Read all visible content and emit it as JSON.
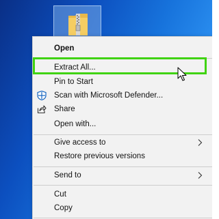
{
  "desktop": {
    "icon": "zip-folder-icon"
  },
  "context_menu": {
    "items": [
      {
        "label": "Open",
        "bold": true
      },
      {
        "label": "Extract All..."
      },
      {
        "label": "Pin to Start"
      },
      {
        "label": "Scan with Microsoft Defender...",
        "icon": "defender-shield-icon"
      },
      {
        "label": "Share",
        "icon": "share-icon"
      },
      {
        "label": "Open with..."
      },
      {
        "label": "Give access to",
        "submenu": true
      },
      {
        "label": "Restore previous versions"
      },
      {
        "label": "Send to",
        "submenu": true
      },
      {
        "label": "Cut"
      },
      {
        "label": "Copy"
      }
    ]
  },
  "annotation": {
    "highlighted_item": "Extract All...",
    "highlight_color": "#40d311"
  }
}
